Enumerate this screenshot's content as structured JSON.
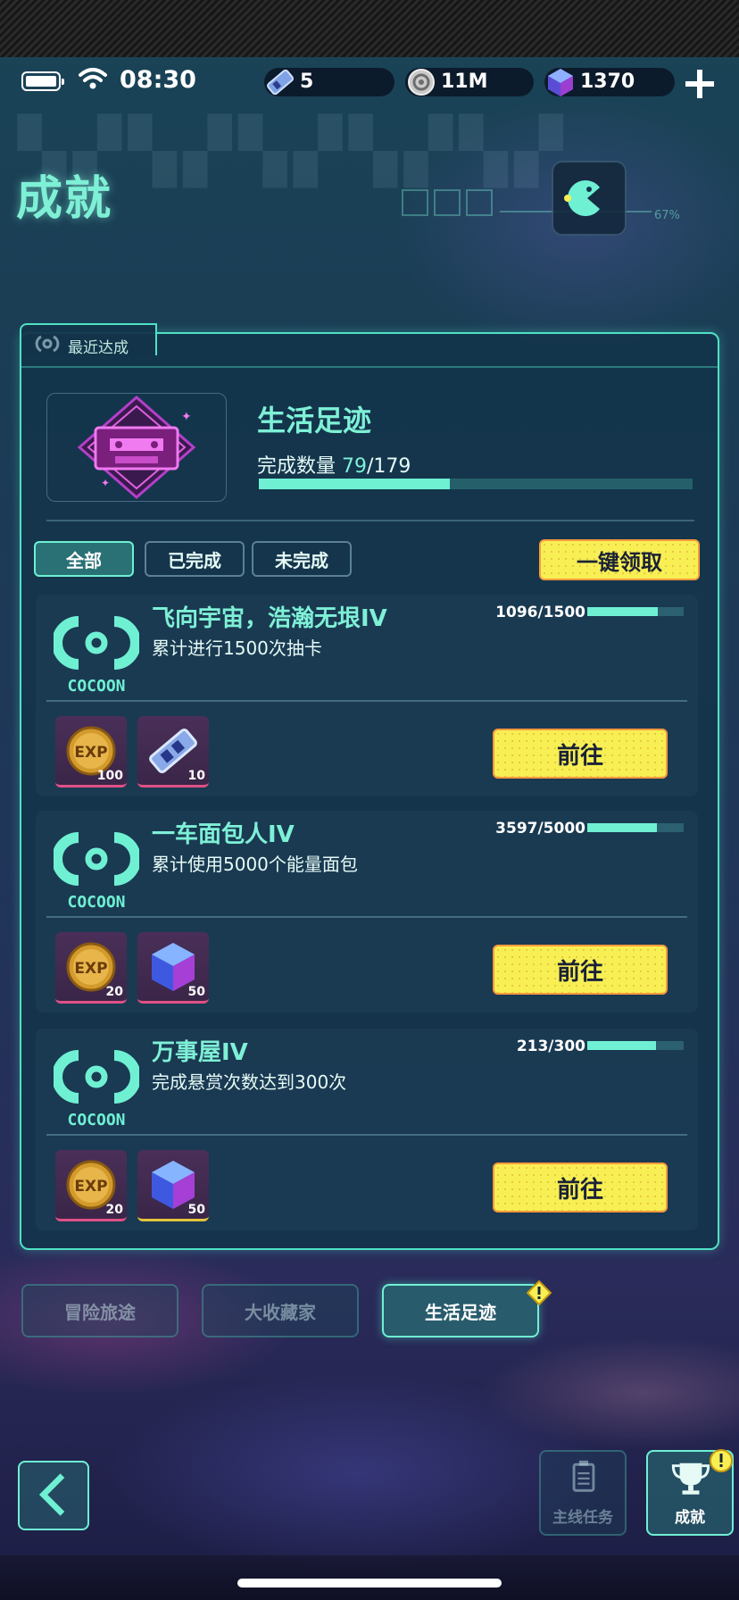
{
  "status": {
    "time": "08:30",
    "currencies": [
      {
        "icon": "ticket-icon",
        "value": "5"
      },
      {
        "icon": "coin-ring-icon",
        "value": "11M"
      },
      {
        "icon": "gem-cube-icon",
        "value": "1370"
      }
    ]
  },
  "header": {
    "title": "成就",
    "deco_percent": "67%"
  },
  "panel": {
    "tab_label": "最近达成",
    "recent": {
      "title": "生活足迹",
      "count_label": "完成数量",
      "done": "79",
      "total": "/179",
      "progress": 0.44
    },
    "filters": [
      "全部",
      "已完成",
      "未完成"
    ],
    "claim_all": "一键领取"
  },
  "tasks": [
    {
      "name": "飞向宇宙，浩瀚无垠IV",
      "desc": "累计进行1500次抽卡",
      "progress_text": "1096/1500",
      "progress": 0.73,
      "logo": "COCOON",
      "rewards": [
        {
          "icon": "exp-coin-icon",
          "qty": "100",
          "border": "pink"
        },
        {
          "icon": "ticket-icon",
          "qty": "10",
          "border": "pink"
        }
      ],
      "go_label": "前往"
    },
    {
      "name": "一车面包人IV",
      "desc": "累计使用5000个能量面包",
      "progress_text": "3597/5000",
      "progress": 0.72,
      "logo": "COCOON",
      "rewards": [
        {
          "icon": "exp-coin-icon",
          "qty": "20",
          "border": "pink"
        },
        {
          "icon": "gem-cube-icon",
          "qty": "50",
          "border": "pink"
        }
      ],
      "go_label": "前往"
    },
    {
      "name": "万事屋IV",
      "desc": "完成悬赏次数达到300次",
      "progress_text": "213/300",
      "progress": 0.71,
      "logo": "COCOON",
      "rewards": [
        {
          "icon": "exp-coin-icon",
          "qty": "20",
          "border": "pink"
        },
        {
          "icon": "gem-cube-icon",
          "qty": "50",
          "border": "gold"
        }
      ],
      "go_label": "前往"
    }
  ],
  "categories": [
    "冒险旅途",
    "大收藏家",
    "生活足迹"
  ],
  "bottom": {
    "main_task": "主线任务",
    "achievement": "成就"
  },
  "colors": {
    "accent": "#6ff0d3",
    "button_yellow": "#f8ef54",
    "button_border": "#ff9a3c",
    "panel_bg": "#13344a"
  }
}
